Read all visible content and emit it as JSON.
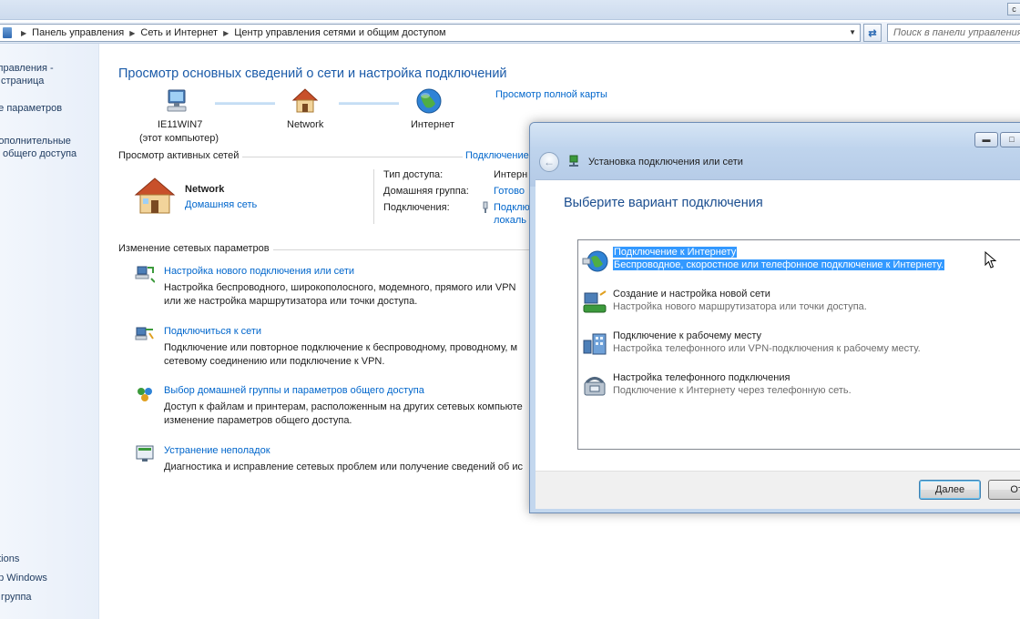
{
  "window": {
    "minimize_glyph": "c"
  },
  "address_bar": {
    "crumbs": [
      "Панель управления",
      "Сеть и Интернет",
      "Центр управления сетями и общим доступом"
    ],
    "search_placeholder": "Поиск в панели управления"
  },
  "sidebar": {
    "items": [
      {
        "label": "управления -\nя страница"
      },
      {
        "label": "ие параметров"
      },
      {
        "label": "дополнительные\nы общего доступа"
      },
      {
        "label": "ptions"
      },
      {
        "label": "ер Windows"
      },
      {
        "label": "я группа"
      }
    ]
  },
  "main": {
    "title": "Просмотр основных сведений о сети и настройка подключений",
    "view_full_map": "Просмотр полной карты",
    "map": {
      "computer_name": "IE11WIN7",
      "computer_caption": "(этот компьютер)",
      "network_name": "Network",
      "internet_label": "Интернет"
    },
    "active_networks": {
      "heading": "Просмотр активных сетей",
      "connect_link": "Подключение",
      "network_name": "Network",
      "network_type": "Домашняя сеть",
      "access_type_label": "Тип доступа:",
      "access_type_value": "Интерн",
      "homegroup_label": "Домашняя группа:",
      "homegroup_value": "Готово",
      "connections_label": "Подключения:",
      "connections_value_1": "Подклю",
      "connections_value_2": "локаль"
    },
    "change_settings": {
      "heading": "Изменение сетевых параметров",
      "tasks": [
        {
          "title": "Настройка нового подключения или сети",
          "desc_1": "Настройка беспроводного, широкополосного, модемного, прямого или VPN",
          "desc_2": "или же настройка маршрутизатора или точки доступа."
        },
        {
          "title": "Подключиться к сети",
          "desc_1": "Подключение или повторное подключение к беспроводному, проводному, м",
          "desc_2": "сетевому соединению или подключение к VPN."
        },
        {
          "title": "Выбор домашней группы и параметров общего доступа",
          "desc_1": "Доступ к файлам и принтерам, расположенным на других сетевых компьюте",
          "desc_2": "изменение параметров общего доступа."
        },
        {
          "title": "Устранение неполадок",
          "desc_1": "Диагностика и исправление сетевых проблем или получение сведений об ис",
          "desc_2": ""
        }
      ]
    }
  },
  "dialog": {
    "title": "Установка подключения или сети",
    "heading": "Выберите вариант подключения",
    "options": [
      {
        "title": "Подключение к Интернету",
        "desc": "Беспроводное, скоростное или телефонное подключение к Интернету.",
        "selected": true
      },
      {
        "title": "Создание и настройка новой сети",
        "desc": "Настройка нового маршрутизатора или точки доступа.",
        "selected": false
      },
      {
        "title": "Подключение к рабочему месту",
        "desc": "Настройка телефонного или VPN-подключения к рабочему месту.",
        "selected": false
      },
      {
        "title": "Настройка телефонного подключения",
        "desc": "Подключение к Интернету через телефонную сеть.",
        "selected": false
      }
    ],
    "next_button": "Далее",
    "cancel_button": "Отм"
  }
}
